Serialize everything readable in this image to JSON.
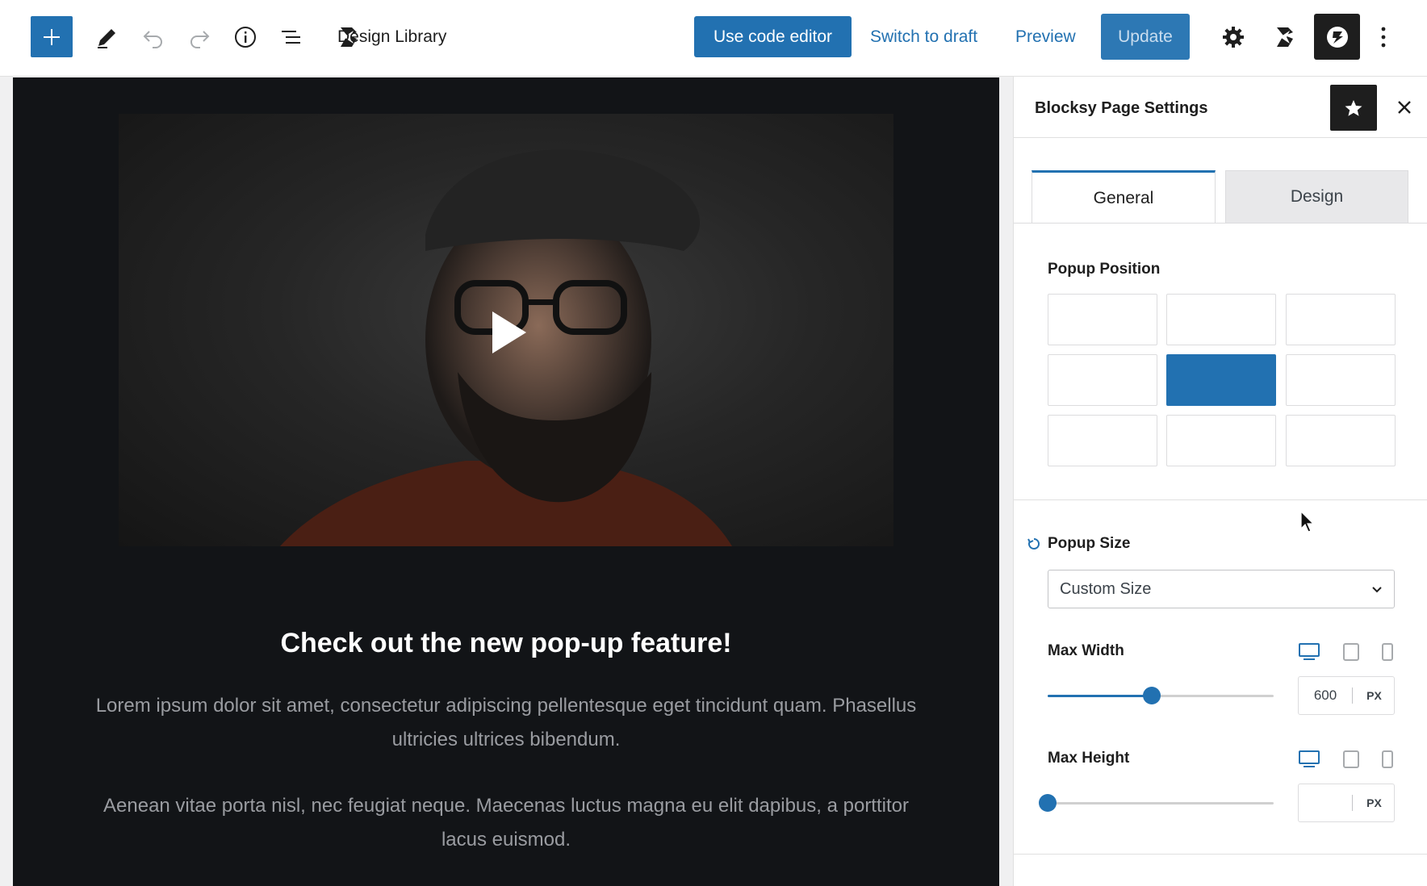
{
  "toolbar": {
    "site_title": "Design Library",
    "code_editor_label": "Use code editor",
    "switch_draft_label": "Switch to draft",
    "preview_label": "Preview",
    "update_label": "Update"
  },
  "popup": {
    "headline": "Check out the new pop-up feature!",
    "paragraph_1": "Lorem ipsum dolor sit amet, consectetur adipiscing pellentesque eget tincidunt quam. Phasellus ultricies ultrices bibendum.",
    "paragraph_2": "Aenean vitae porta nisl, nec feugiat neque. Maecenas luctus magna eu elit dapibus, a porttitor lacus euismod."
  },
  "sidebar": {
    "title": "Blocksy Page Settings",
    "tabs": [
      {
        "label": "General",
        "active": true
      },
      {
        "label": "Design",
        "active": false
      }
    ],
    "popup_position": {
      "label": "Popup Position",
      "selected": "middle-center"
    },
    "popup_size": {
      "label": "Popup Size",
      "value": "Custom Size"
    },
    "max_width": {
      "label": "Max Width",
      "value": "600",
      "unit": "PX",
      "slider_fraction": 0.46
    },
    "max_height": {
      "label": "Max Height",
      "value": "",
      "unit": "PX",
      "slider_fraction": 0.0
    }
  },
  "colors": {
    "accent": "#2271b1",
    "popup_bg": "#121417",
    "dark": "#1e1e1e"
  }
}
